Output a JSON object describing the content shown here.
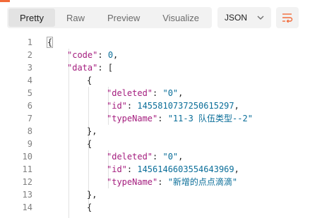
{
  "toolbar": {
    "tabs": [
      {
        "label": "Pretty",
        "active": true
      },
      {
        "label": "Raw",
        "active": false
      },
      {
        "label": "Preview",
        "active": false
      },
      {
        "label": "Visualize",
        "active": false
      }
    ],
    "format": "JSON",
    "wrap_icon": "text-wrap-icon",
    "chevron_icon": "chevron-down-icon"
  },
  "colors": {
    "accent": "#f26b3a",
    "key": "#a41d7e",
    "value": "#0b6e99"
  },
  "lines": [
    {
      "n": "1",
      "tokens": [
        {
          "t": "{",
          "c": "punc"
        }
      ]
    },
    {
      "n": "2",
      "tokens": [
        {
          "t": "\"code\"",
          "c": "key"
        },
        {
          "t": ": ",
          "c": "punc"
        },
        {
          "t": "0",
          "c": "num"
        },
        {
          "t": ",",
          "c": "punc"
        }
      ]
    },
    {
      "n": "3",
      "tokens": [
        {
          "t": "\"data\"",
          "c": "key"
        },
        {
          "t": ": [",
          "c": "punc"
        }
      ]
    },
    {
      "n": "4",
      "tokens": [
        {
          "t": "{",
          "c": "punc"
        }
      ]
    },
    {
      "n": "5",
      "tokens": [
        {
          "t": "\"deleted\"",
          "c": "key"
        },
        {
          "t": ": ",
          "c": "punc"
        },
        {
          "t": "\"0\"",
          "c": "str"
        },
        {
          "t": ",",
          "c": "punc"
        }
      ]
    },
    {
      "n": "6",
      "tokens": [
        {
          "t": "\"id\"",
          "c": "key"
        },
        {
          "t": ": ",
          "c": "punc"
        },
        {
          "t": "1455810737250615297",
          "c": "num"
        },
        {
          "t": ",",
          "c": "punc"
        }
      ]
    },
    {
      "n": "7",
      "tokens": [
        {
          "t": "\"typeName\"",
          "c": "key"
        },
        {
          "t": ": ",
          "c": "punc"
        },
        {
          "t": "\"11-3 队伍类型--2\"",
          "c": "str"
        }
      ]
    },
    {
      "n": "8",
      "tokens": [
        {
          "t": "},",
          "c": "punc"
        }
      ]
    },
    {
      "n": "9",
      "tokens": [
        {
          "t": "{",
          "c": "punc"
        }
      ]
    },
    {
      "n": "10",
      "tokens": [
        {
          "t": "\"deleted\"",
          "c": "key"
        },
        {
          "t": ": ",
          "c": "punc"
        },
        {
          "t": "\"0\"",
          "c": "str"
        },
        {
          "t": ",",
          "c": "punc"
        }
      ]
    },
    {
      "n": "11",
      "tokens": [
        {
          "t": "\"id\"",
          "c": "key"
        },
        {
          "t": ": ",
          "c": "punc"
        },
        {
          "t": "1456146603554643969",
          "c": "num"
        },
        {
          "t": ",",
          "c": "punc"
        }
      ]
    },
    {
      "n": "12",
      "tokens": [
        {
          "t": "\"typeName\"",
          "c": "key"
        },
        {
          "t": ": ",
          "c": "punc"
        },
        {
          "t": "\"新增的点点滴滴\"",
          "c": "str"
        }
      ]
    },
    {
      "n": "13",
      "tokens": [
        {
          "t": "},",
          "c": "punc"
        }
      ]
    },
    {
      "n": "14",
      "tokens": [
        {
          "t": "{",
          "c": "punc"
        }
      ]
    }
  ]
}
